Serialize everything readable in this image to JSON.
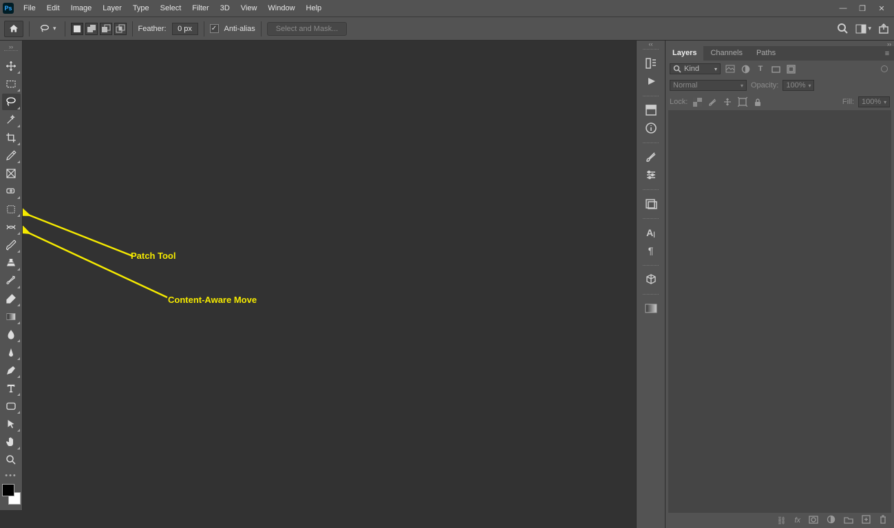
{
  "menu": {
    "items": [
      "File",
      "Edit",
      "Image",
      "Layer",
      "Type",
      "Select",
      "Filter",
      "3D",
      "View",
      "Window",
      "Help"
    ]
  },
  "options": {
    "feather_label": "Feather:",
    "feather_value": "0 px",
    "antialias_label": "Anti-alias",
    "select_mask": "Select and Mask..."
  },
  "annotations": {
    "patch": "Patch Tool",
    "cam": "Content-Aware Move"
  },
  "layers": {
    "tab_layers": "Layers",
    "tab_channels": "Channels",
    "tab_paths": "Paths",
    "filter_kind": "Kind",
    "blend_mode": "Normal",
    "opacity_label": "Opacity:",
    "opacity_value": "100%",
    "lock_label": "Lock:",
    "fill_label": "Fill:",
    "fill_value": "100%"
  }
}
